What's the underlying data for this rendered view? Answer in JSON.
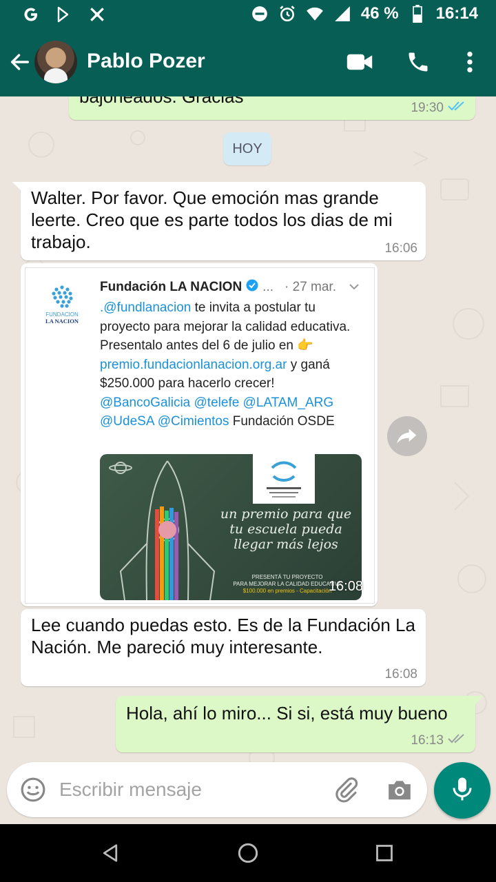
{
  "status_bar": {
    "battery": "46 %",
    "time": "16:14"
  },
  "app_bar": {
    "contact_name": "Pablo Pozer"
  },
  "chat": {
    "date_separator": "HOY",
    "messages": [
      {
        "direction": "out",
        "text": "bajoneados. Gracias",
        "time": "19:30",
        "status": "read"
      },
      {
        "direction": "in",
        "text": "Walter. Por favor. Que emoción mas grande leerte. Creo que es parte todos los dias de mi trabajo.",
        "time": "16:06"
      },
      {
        "direction": "in",
        "type": "image",
        "time": "16:08",
        "tweet": {
          "account": "Fundación LA NACION",
          "date": "· 27 mar.",
          "ellipsis": "...",
          "handle_mention": ".@fundlanacion",
          "text_1": " te invita a postular tu proyecto para mejorar la calidad educativa. Presentalo antes del 6 de julio en ",
          "emoji": "👉",
          "link": "premio.fundacionlanacion.org.ar",
          "text_2": " y ganá $250.000 para hacerlo crecer!",
          "mentions_1": "@BancoGalicia @telefe @LATAM_ARG",
          "mentions_2": "@UdeSA @Cimientos",
          "text_3": " Fundación OSDE",
          "logo_text_1": "FUNDACION",
          "logo_text_2": "LA NACION",
          "image_text": "un premio para que tu escuela pueda llegar más lejos",
          "image_small_1": "PRESENTÁ TU PROYECTO",
          "image_small_2": "PARA MEJORAR LA CALIDAD EDUCATIVA",
          "image_small_3": "$100.000 en premios - Capacitación"
        }
      },
      {
        "direction": "in",
        "text": "Lee cuando puedas esto. Es de la Fundación La Nación.  Me pareció muy interesante.",
        "time": "16:08"
      },
      {
        "direction": "out",
        "text": "Hola, ahí lo miro... Si si, está muy bueno",
        "time": "16:13",
        "status": "read"
      }
    ]
  },
  "composer": {
    "placeholder": "Escribir mensaje"
  },
  "colors": {
    "header": "#075e54",
    "incoming": "#ffffff",
    "outgoing": "#dcf8c6",
    "read_ticks": "#4fc3f7",
    "mic_button": "#00897b"
  }
}
